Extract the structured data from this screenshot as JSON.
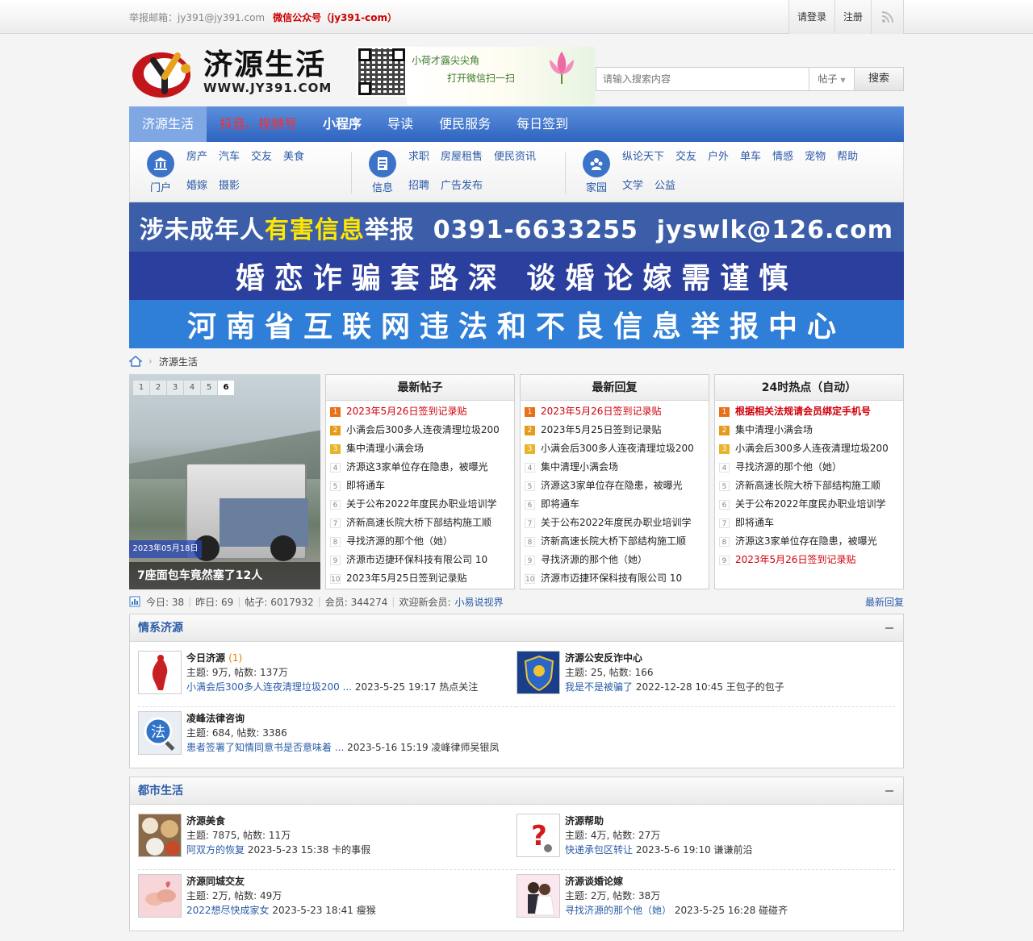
{
  "topbar": {
    "email": "举报邮箱：jy391@jy391.com",
    "wechat": "微信公众号（jy391-com）",
    "login": "请登录",
    "register": "注册"
  },
  "header": {
    "logo_title": "济源生活",
    "logo_url": "WWW.JY391.COM",
    "qr_line1": "小荷才露尖尖角",
    "qr_line2": "打开微信扫一扫",
    "search_placeholder": "请输入搜索内容",
    "search_type": "帖子",
    "search_button": "搜索"
  },
  "nav": {
    "items": [
      "济源生活",
      "抖音、视频号",
      "小程序",
      "导读",
      "便民服务",
      "每日签到"
    ]
  },
  "subnav": {
    "groups": [
      {
        "label": "门户",
        "links": [
          "房产",
          "汽车",
          "交友",
          "美食",
          "婚嫁",
          "摄影"
        ]
      },
      {
        "label": "信息",
        "links": [
          "求职",
          "房屋租售",
          "便民资讯",
          "招聘",
          "广告发布"
        ]
      },
      {
        "label": "家园",
        "links": [
          "纵论天下",
          "交友",
          "户外",
          "单车",
          "情感",
          "宠物",
          "帮助",
          "文学",
          "公益"
        ]
      }
    ]
  },
  "banners": {
    "b1_pre": "涉未成年人",
    "b1_hl": "有害信息",
    "b1_post": "举报  0391-6633255  jyswlk@126.com",
    "b2": "婚恋诈骗套路深 谈婚论嫁需谨慎",
    "b3": "河南省互联网违法和不良信息举报中心"
  },
  "breadcrumb": {
    "current": "济源生活"
  },
  "slide": {
    "pages": [
      "1",
      "2",
      "3",
      "4",
      "5",
      "6"
    ],
    "date": "2023年05月18日",
    "caption": "7座面包车竟然塞了12人"
  },
  "lists": {
    "latest_posts": {
      "title": "最新帖子",
      "items": [
        "2023年5月26日签到记录贴",
        "小满会后300多人连夜清理垃圾200",
        "集中清理小满会场",
        "济源这3家单位存在隐患，被曝光",
        "即将通车",
        "关于公布2022年度民办职业培训学",
        "济新高速长院大桥下部结构施工顺",
        "寻找济源的那个他（她）",
        "济源市迈捷环保科技有限公司 10",
        "2023年5月25日签到记录贴"
      ]
    },
    "latest_replies": {
      "title": "最新回复",
      "items": [
        "2023年5月26日签到记录贴",
        "2023年5月25日签到记录贴",
        "小满会后300多人连夜清理垃圾200",
        "集中清理小满会场",
        "济源这3家单位存在隐患，被曝光",
        "即将通车",
        "关于公布2022年度民办职业培训学",
        "济新高速长院大桥下部结构施工顺",
        "寻找济源的那个他（她）",
        "济源市迈捷环保科技有限公司 10"
      ]
    },
    "hot": {
      "title": "24时热点（自动）",
      "items": [
        "根据相关法规请会员绑定手机号",
        "集中清理小满会场",
        "小满会后300多人连夜清理垃圾200",
        "寻找济源的那个他（她）",
        "济新高速长院大桥下部结构施工顺",
        "关于公布2022年度民办职业培训学",
        "即将通车",
        "济源这3家单位存在隐患，被曝光",
        "2023年5月26日签到记录贴"
      ]
    }
  },
  "stats": {
    "today": "今日: 38",
    "yesterday": "昨日: 69",
    "posts": "帖子: 6017932",
    "members": "会员: 344274",
    "welcome": "欢迎新会员:",
    "new_member": "小易说视界",
    "latest_reply_link": "最新回复"
  },
  "sections": [
    {
      "title": "情系济源",
      "forums": [
        {
          "name": "今日济源",
          "count": "(1)",
          "stats": "主题: 9万, 帖数: 137万",
          "last_link": "小满会后300多人连夜清理垃圾200 ...",
          "last_meta": "2023-5-25 19:17 热点关注"
        },
        {
          "name": "济源公安反诈中心",
          "count": "",
          "stats": "主题: 25, 帖数: 166",
          "last_link": "我是不是被骗了",
          "last_meta": "2022-12-28 10:45 王包子的包子"
        },
        {
          "name": "凌峰法律咨询",
          "count": "",
          "stats": "主题: 684, 帖数: 3386",
          "last_link": "患者签署了知情同意书是否意味着 ...",
          "last_meta": "2023-5-16 15:19 凌峰律师吴银凤"
        }
      ]
    },
    {
      "title": "都市生活",
      "forums": [
        {
          "name": "济源美食",
          "count": "",
          "stats": "主题: 7875, 帖数: 11万",
          "last_link": "阿双方的恢复",
          "last_meta": "2023-5-23 15:38 卡的事假"
        },
        {
          "name": "济源帮助",
          "count": "",
          "stats": "主题: 4万, 帖数: 27万",
          "last_link": "快递承包区转让",
          "last_meta": "2023-5-6 19:10 谦谦前沿"
        },
        {
          "name": "济源同城交友",
          "count": "",
          "stats": "主题: 2万, 帖数: 49万",
          "last_link": "2022想尽快成家女",
          "last_meta": "2023-5-23 18:41 瘦猴"
        },
        {
          "name": "济源谈婚论嫁",
          "count": "",
          "stats": "主题: 2万, 帖数: 38万",
          "last_link": "寻找济源的那个他（她）",
          "last_meta": "2023-5-25 16:28 碰碰齐"
        }
      ]
    }
  ]
}
